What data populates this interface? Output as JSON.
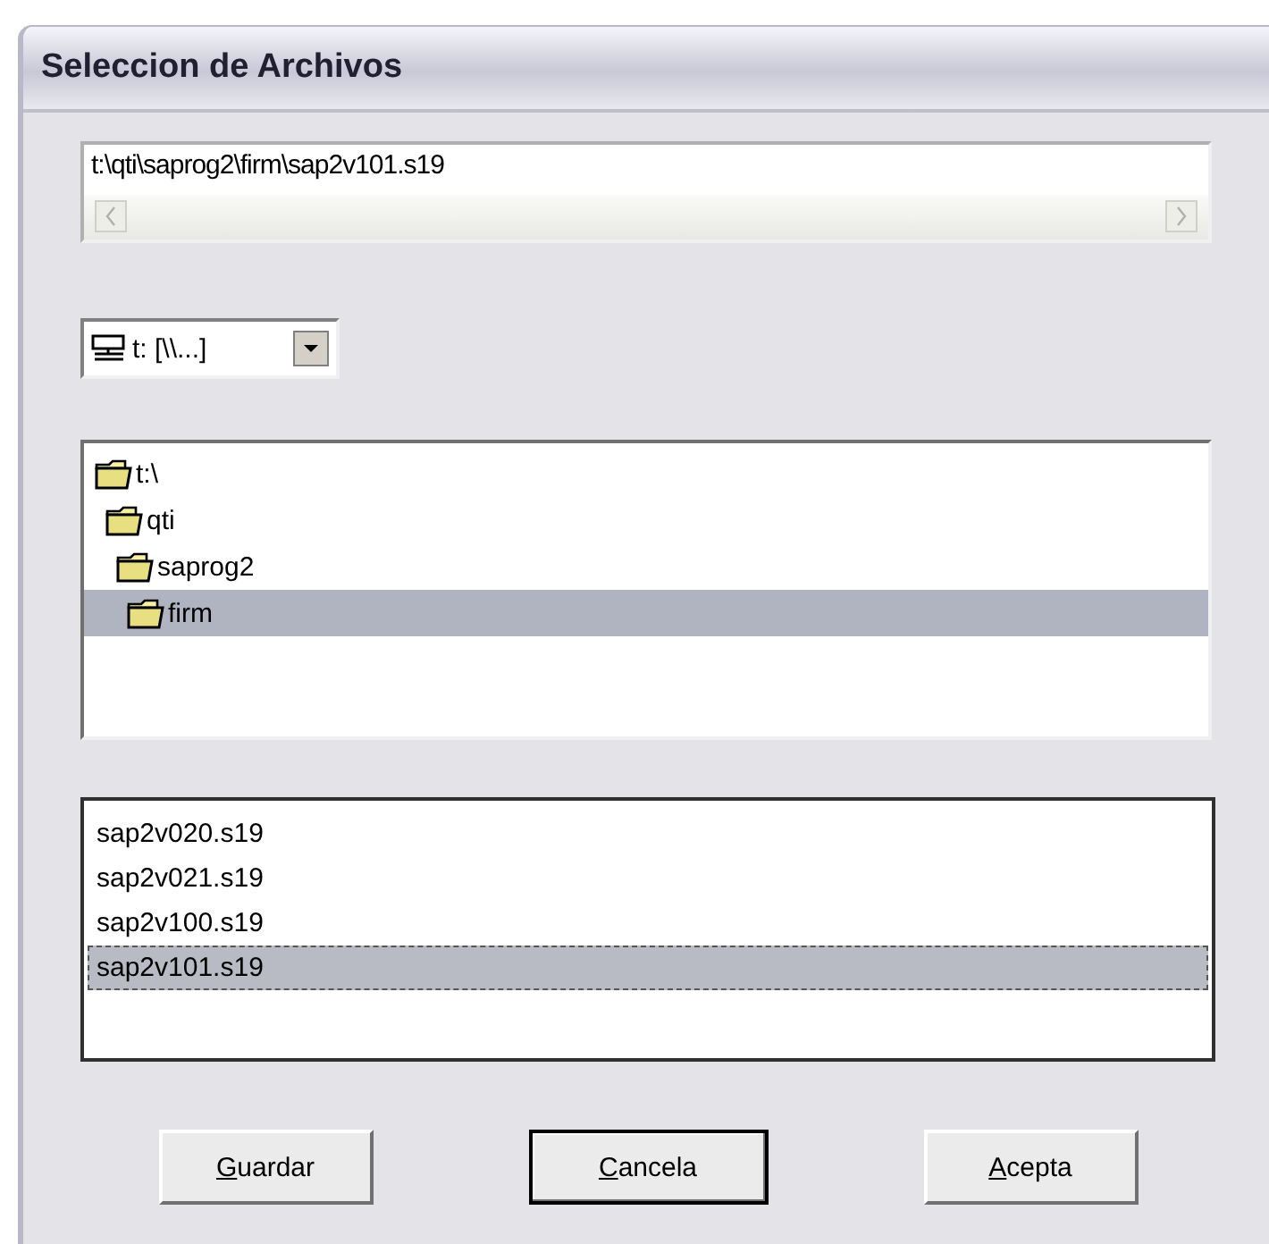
{
  "window": {
    "title": "Seleccion de Archivos"
  },
  "path_field": {
    "value": "t:\\qti\\saprog2\\firm\\sap2v101.s19"
  },
  "drive_select": {
    "value": "t: [\\\\...]"
  },
  "folders": [
    {
      "name": "t:\\",
      "selected": false,
      "children": [
        {
          "name": "qti",
          "selected": false,
          "children": [
            {
              "name": "saprog2",
              "selected": false,
              "children": [
                {
                  "name": "firm",
                  "selected": true
                }
              ]
            }
          ]
        }
      ]
    }
  ],
  "files": [
    {
      "name": "sap2v020.s19",
      "selected": false
    },
    {
      "name": "sap2v021.s19",
      "selected": false
    },
    {
      "name": "sap2v100.s19",
      "selected": false
    },
    {
      "name": "sap2v101.s19",
      "selected": true
    }
  ],
  "buttons": [
    {
      "label": "Guardar",
      "default": false
    },
    {
      "label": "Cancela",
      "default": true
    },
    {
      "label": "Acepta",
      "default": false
    }
  ]
}
